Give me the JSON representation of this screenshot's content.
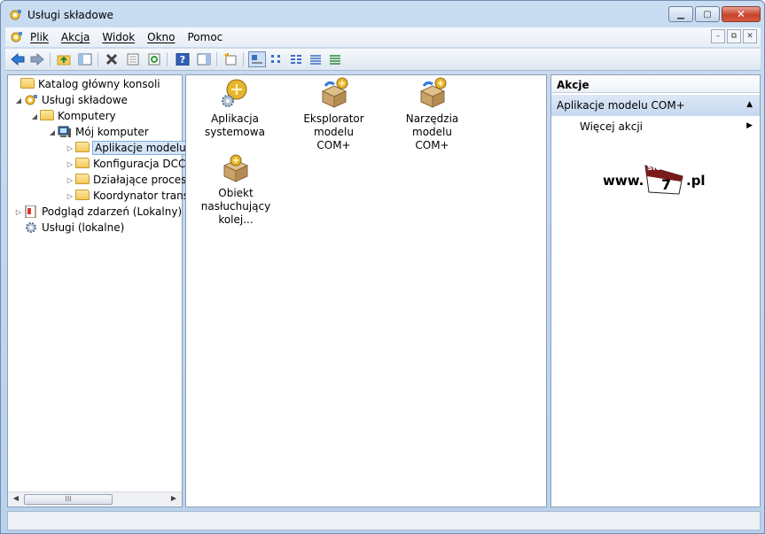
{
  "window": {
    "title": "Usługi składowe"
  },
  "menu": {
    "items": [
      "Plik",
      "Akcja",
      "Widok",
      "Okno",
      "Pomoc"
    ]
  },
  "tree": {
    "items": [
      {
        "label": "Katalog główny konsoli",
        "icon": "folder-icon"
      },
      {
        "label": "Usługi składowe",
        "icon": "component-services-icon"
      },
      {
        "label": "Komputery",
        "icon": "folder-icon"
      },
      {
        "label": "Mój komputer",
        "icon": "computer-icon"
      },
      {
        "label": "Aplikacje modelu",
        "icon": "folder-icon",
        "selected": true
      },
      {
        "label": "Konfiguracja DCC",
        "icon": "folder-icon"
      },
      {
        "label": "Działające procesy",
        "icon": "folder-icon"
      },
      {
        "label": "Koordynator trans",
        "icon": "folder-icon"
      },
      {
        "label": "Podgląd zdarzeń (Lokalny)",
        "icon": "event-viewer-icon"
      },
      {
        "label": "Usługi (lokalne)",
        "icon": "gear-icon"
      }
    ],
    "scrollbar_label": "III"
  },
  "list": {
    "items": [
      {
        "line1": "Aplikacja",
        "line2": "systemowa"
      },
      {
        "line1": "Eksplorator modelu",
        "line2": "COM+"
      },
      {
        "line1": "Narzędzia modelu",
        "line2": "COM+"
      },
      {
        "line1": "Obiekt",
        "line2": "nasłuchujący kolej..."
      }
    ]
  },
  "actions": {
    "header": "Akcje",
    "section": "Aplikacje modelu COM+",
    "item": "Więcej akcji"
  },
  "watermark": {
    "prefix": "www.",
    "badge_top": "slow",
    "badge_num": "7",
    "suffix": ".pl"
  }
}
